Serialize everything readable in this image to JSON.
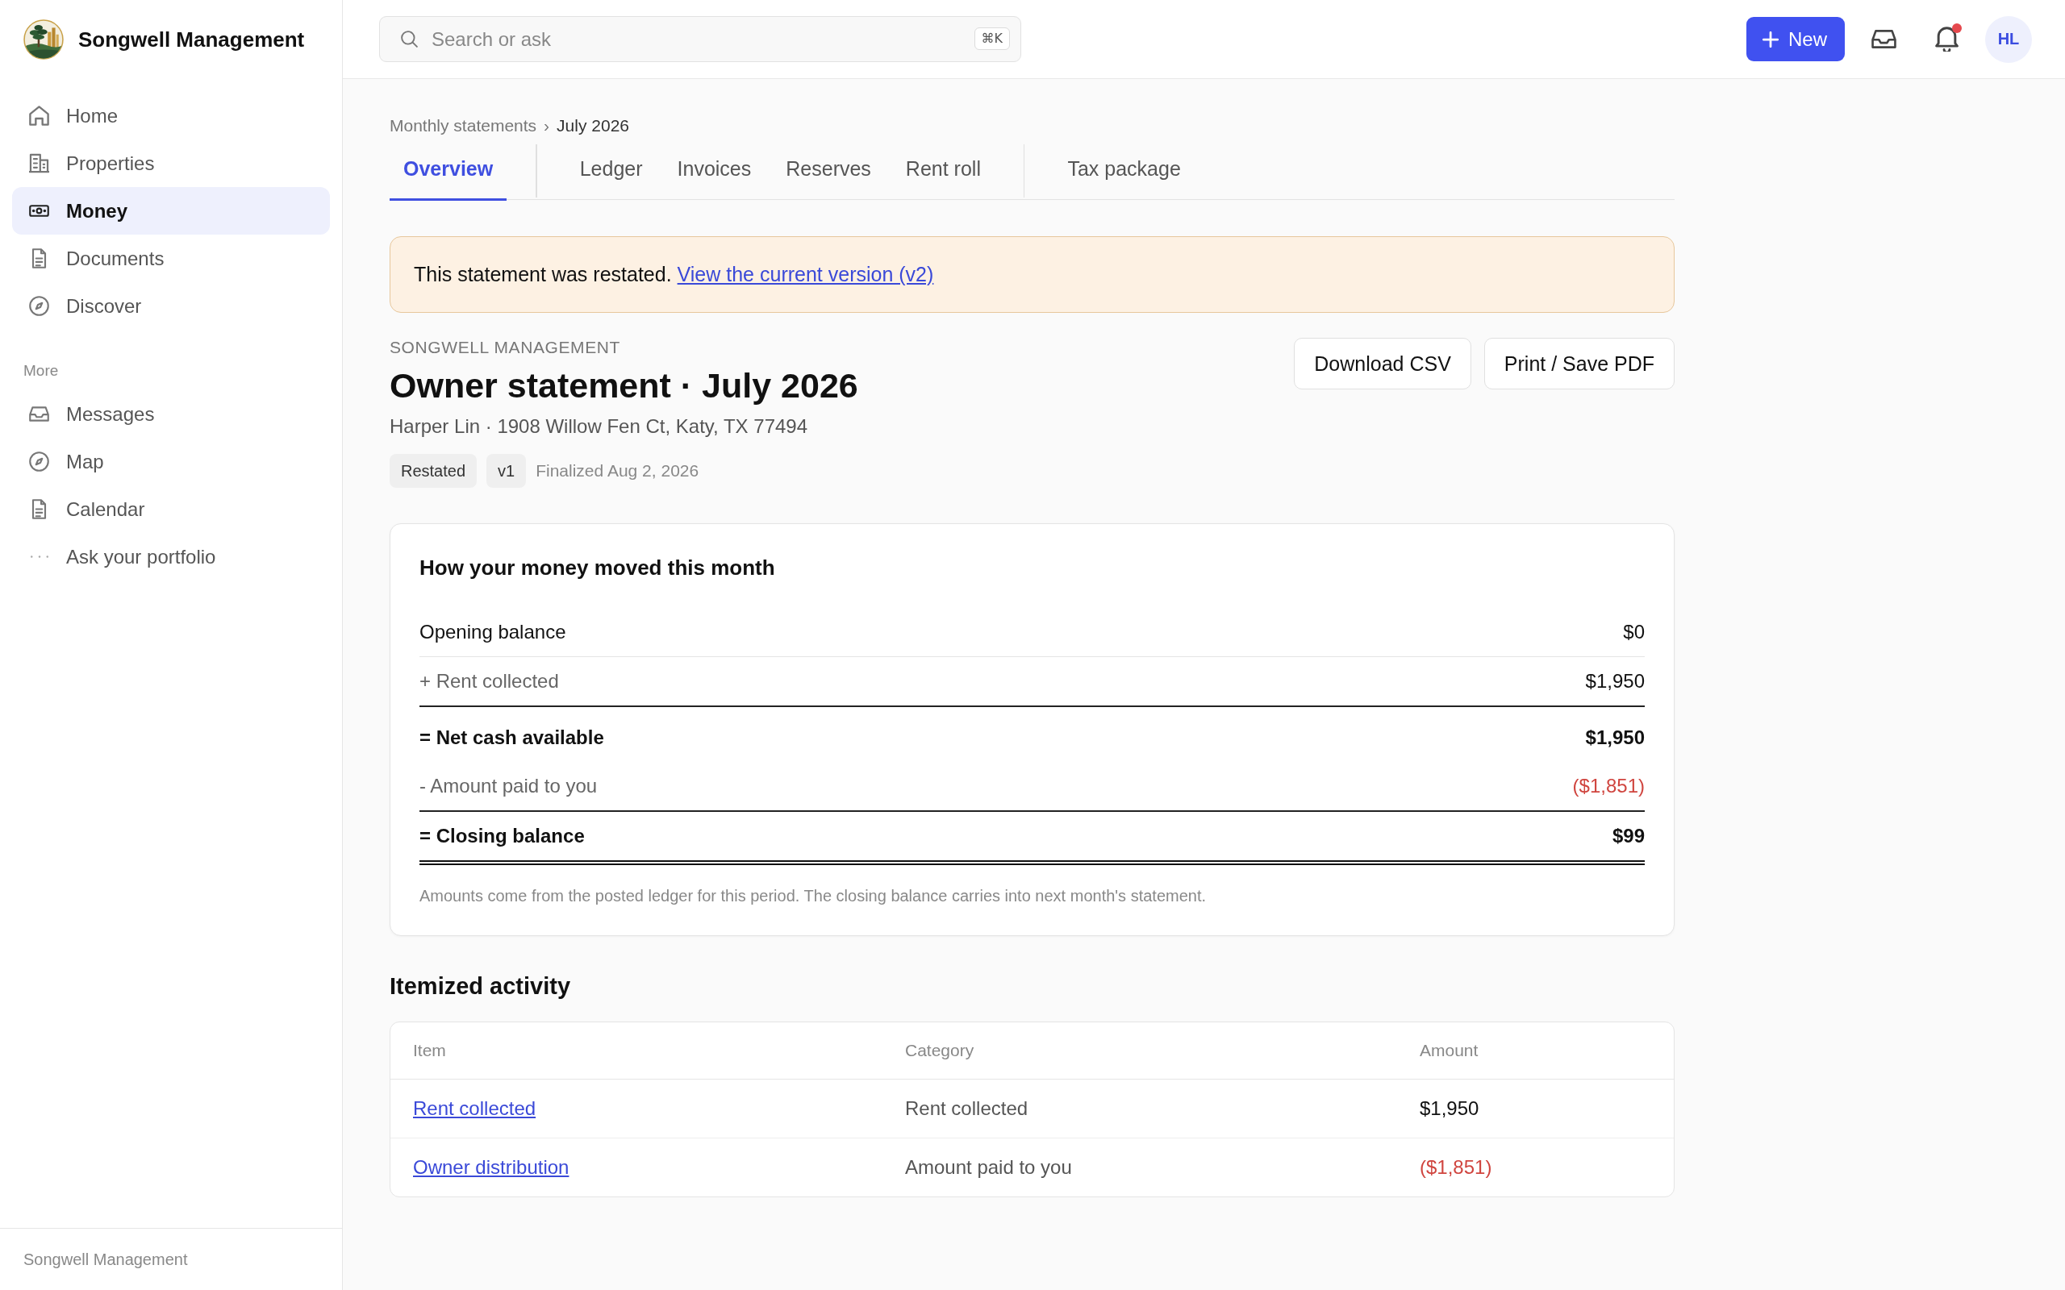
{
  "sidebar": {
    "brand": "Songwell Management",
    "nav": [
      {
        "label": "Home",
        "selected": false
      },
      {
        "label": "Properties",
        "selected": false
      },
      {
        "label": "Money",
        "selected": true
      },
      {
        "label": "Documents",
        "selected": false
      },
      {
        "label": "Discover",
        "selected": false
      }
    ],
    "more_heading": "More",
    "more": [
      {
        "label": "Messages",
        "selected": false
      },
      {
        "label": "Map",
        "selected": false
      },
      {
        "label": "Calendar",
        "selected": false
      },
      {
        "label": "Ask your portfolio",
        "selected": false
      }
    ],
    "footer": "Songwell Management"
  },
  "topbar": {
    "search": {
      "placeholder": "Search or ask",
      "shortcut": "⌘K"
    },
    "new_button": "New",
    "notifications": {
      "unread": true
    },
    "avatar": "HL"
  },
  "breadcrumb": {
    "items": [
      "Monthly statements",
      "July 2026"
    ],
    "separator": "›"
  },
  "tabs": {
    "groups": [
      {
        "tabs": [
          {
            "label": "Overview",
            "selected": true
          }
        ]
      },
      {
        "tabs": [
          {
            "label": "Ledger",
            "selected": false
          },
          {
            "label": "Invoices",
            "selected": false
          },
          {
            "label": "Reserves",
            "selected": false
          },
          {
            "label": "Rent roll",
            "selected": false
          }
        ]
      },
      {
        "tabs": [
          {
            "label": "Tax package",
            "selected": false
          }
        ]
      }
    ]
  },
  "banner": {
    "text": "This statement was restated.",
    "link": "View the current version (v2)"
  },
  "statement": {
    "org": "SONGWELL MANAGEMENT",
    "title": "Owner statement · July 2026",
    "subtitle": "Harper Lin · 1908 Willow Fen Ct, Katy, TX 77494",
    "tags": [
      "Restated",
      "v1"
    ],
    "finalized": "Finalized Aug 2, 2026",
    "actions": [
      "Download CSV",
      "Print / Save PDF"
    ]
  },
  "summary": {
    "title": "How your money moved this month",
    "rows": [
      {
        "kind": "opening",
        "label": "Opening balance",
        "value": "$0",
        "negative": false
      },
      {
        "kind": "item",
        "label": "+ Rent collected",
        "value": "$1,950",
        "negative": false
      },
      {
        "kind": "subtotal",
        "label": "= Net cash available",
        "value": "$1,950",
        "negative": false
      },
      {
        "kind": "item",
        "label": "- Amount paid to you",
        "value": "($1,851)",
        "negative": true
      },
      {
        "kind": "total",
        "label": "= Closing balance",
        "value": "$99",
        "negative": false
      }
    ],
    "note": "Amounts come from the posted ledger for this period. The closing balance carries into next month's statement."
  },
  "itemized": {
    "title": "Itemized activity",
    "columns": [
      "Item",
      "Category",
      "Amount"
    ],
    "rows": [
      {
        "item": "Rent collected",
        "category": "Rent collected",
        "amount": "$1,950",
        "negative": false
      },
      {
        "item": "Owner distribution",
        "category": "Amount paid to you",
        "amount": "($1,851)",
        "negative": true
      }
    ]
  }
}
